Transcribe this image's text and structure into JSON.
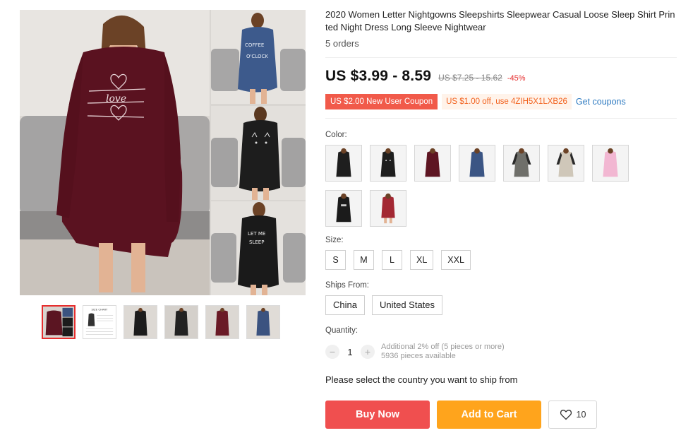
{
  "product": {
    "title": "2020 Women Letter Nightgowns Sleepshirts Sleepwear Casual Loose Sleep Shirt Printed Night Dress Long Sleeve Nightwear",
    "orders": "5 orders",
    "price": "US $3.99 - 8.59",
    "old_price": "US $7.25 - 15.62",
    "discount": "-45%"
  },
  "coupons": {
    "new_user": "US $2.00 New User Coupon",
    "code_offer": "US $1.00 off, use 4ZIH5X1LXB26",
    "link": "Get coupons"
  },
  "gallery": {
    "main_print": "love",
    "side_prints": [
      "COFFEE O'CLOCK",
      "cat face",
      "LET ME SLEEP"
    ],
    "thumbnails": [
      {
        "color": "#5b1522",
        "active": true
      },
      {
        "color": "#ffffff",
        "text": "SIZE CHART",
        "active": false
      },
      {
        "color": "#1c1c1c",
        "active": false
      },
      {
        "color": "#222222",
        "active": false
      },
      {
        "color": "#6a1a26",
        "active": false
      },
      {
        "color": "#3b5380",
        "active": false
      }
    ]
  },
  "color": {
    "label": "Color:",
    "options": [
      {
        "name": "black-plain",
        "color": "#1e1e1e"
      },
      {
        "name": "black-cat",
        "color": "#1e1e1e"
      },
      {
        "name": "burgundy",
        "color": "#5e1522"
      },
      {
        "name": "blue",
        "color": "#3b5584"
      },
      {
        "name": "grey-raglan",
        "color": "#6f6f6a"
      },
      {
        "name": "beige-raglan",
        "color": "#cfc7b9"
      },
      {
        "name": "pink",
        "color": "#f2b7d2"
      },
      {
        "name": "black-print",
        "color": "#1b1b1b"
      },
      {
        "name": "red-short",
        "color": "#a32833"
      }
    ]
  },
  "size": {
    "label": "Size:",
    "options": [
      "S",
      "M",
      "L",
      "XL",
      "XXL"
    ]
  },
  "ships_from": {
    "label": "Ships From:",
    "options": [
      "China",
      "United States"
    ]
  },
  "quantity": {
    "label": "Quantity:",
    "value": "1",
    "minus": "−",
    "plus": "+",
    "note1": "Additional 2% off (5 pieces or more)",
    "note2": "5936 pieces available"
  },
  "ship_message": "Please select the country you want to ship from",
  "actions": {
    "buy_now": "Buy Now",
    "add_to_cart": "Add to Cart",
    "wishlist_count": "10"
  },
  "colors": {
    "accent_red": "#f04f4f",
    "accent_orange": "#ffa41c",
    "link_blue": "#2f7bc1"
  }
}
